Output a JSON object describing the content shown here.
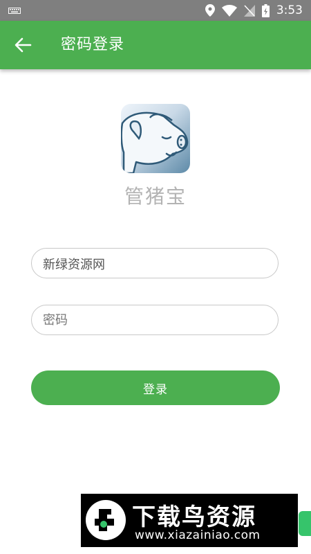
{
  "status_bar": {
    "time": "3:53",
    "icons": [
      "keyboard-icon",
      "location-icon",
      "wifi-icon",
      "no-sim-icon",
      "battery-icon"
    ]
  },
  "app_bar": {
    "title": "密码登录",
    "back_icon": "arrow-left-icon",
    "color": "#4caf50"
  },
  "app": {
    "name": "管猪宝",
    "logo_icon": "pig-icon"
  },
  "form": {
    "username_value": "新绿资源网",
    "password_placeholder": "密码",
    "login_label": "登录",
    "button_color": "#4caf50"
  },
  "watermark": {
    "title": "下载鸟资源",
    "url": "www.xiazainiao.com"
  }
}
